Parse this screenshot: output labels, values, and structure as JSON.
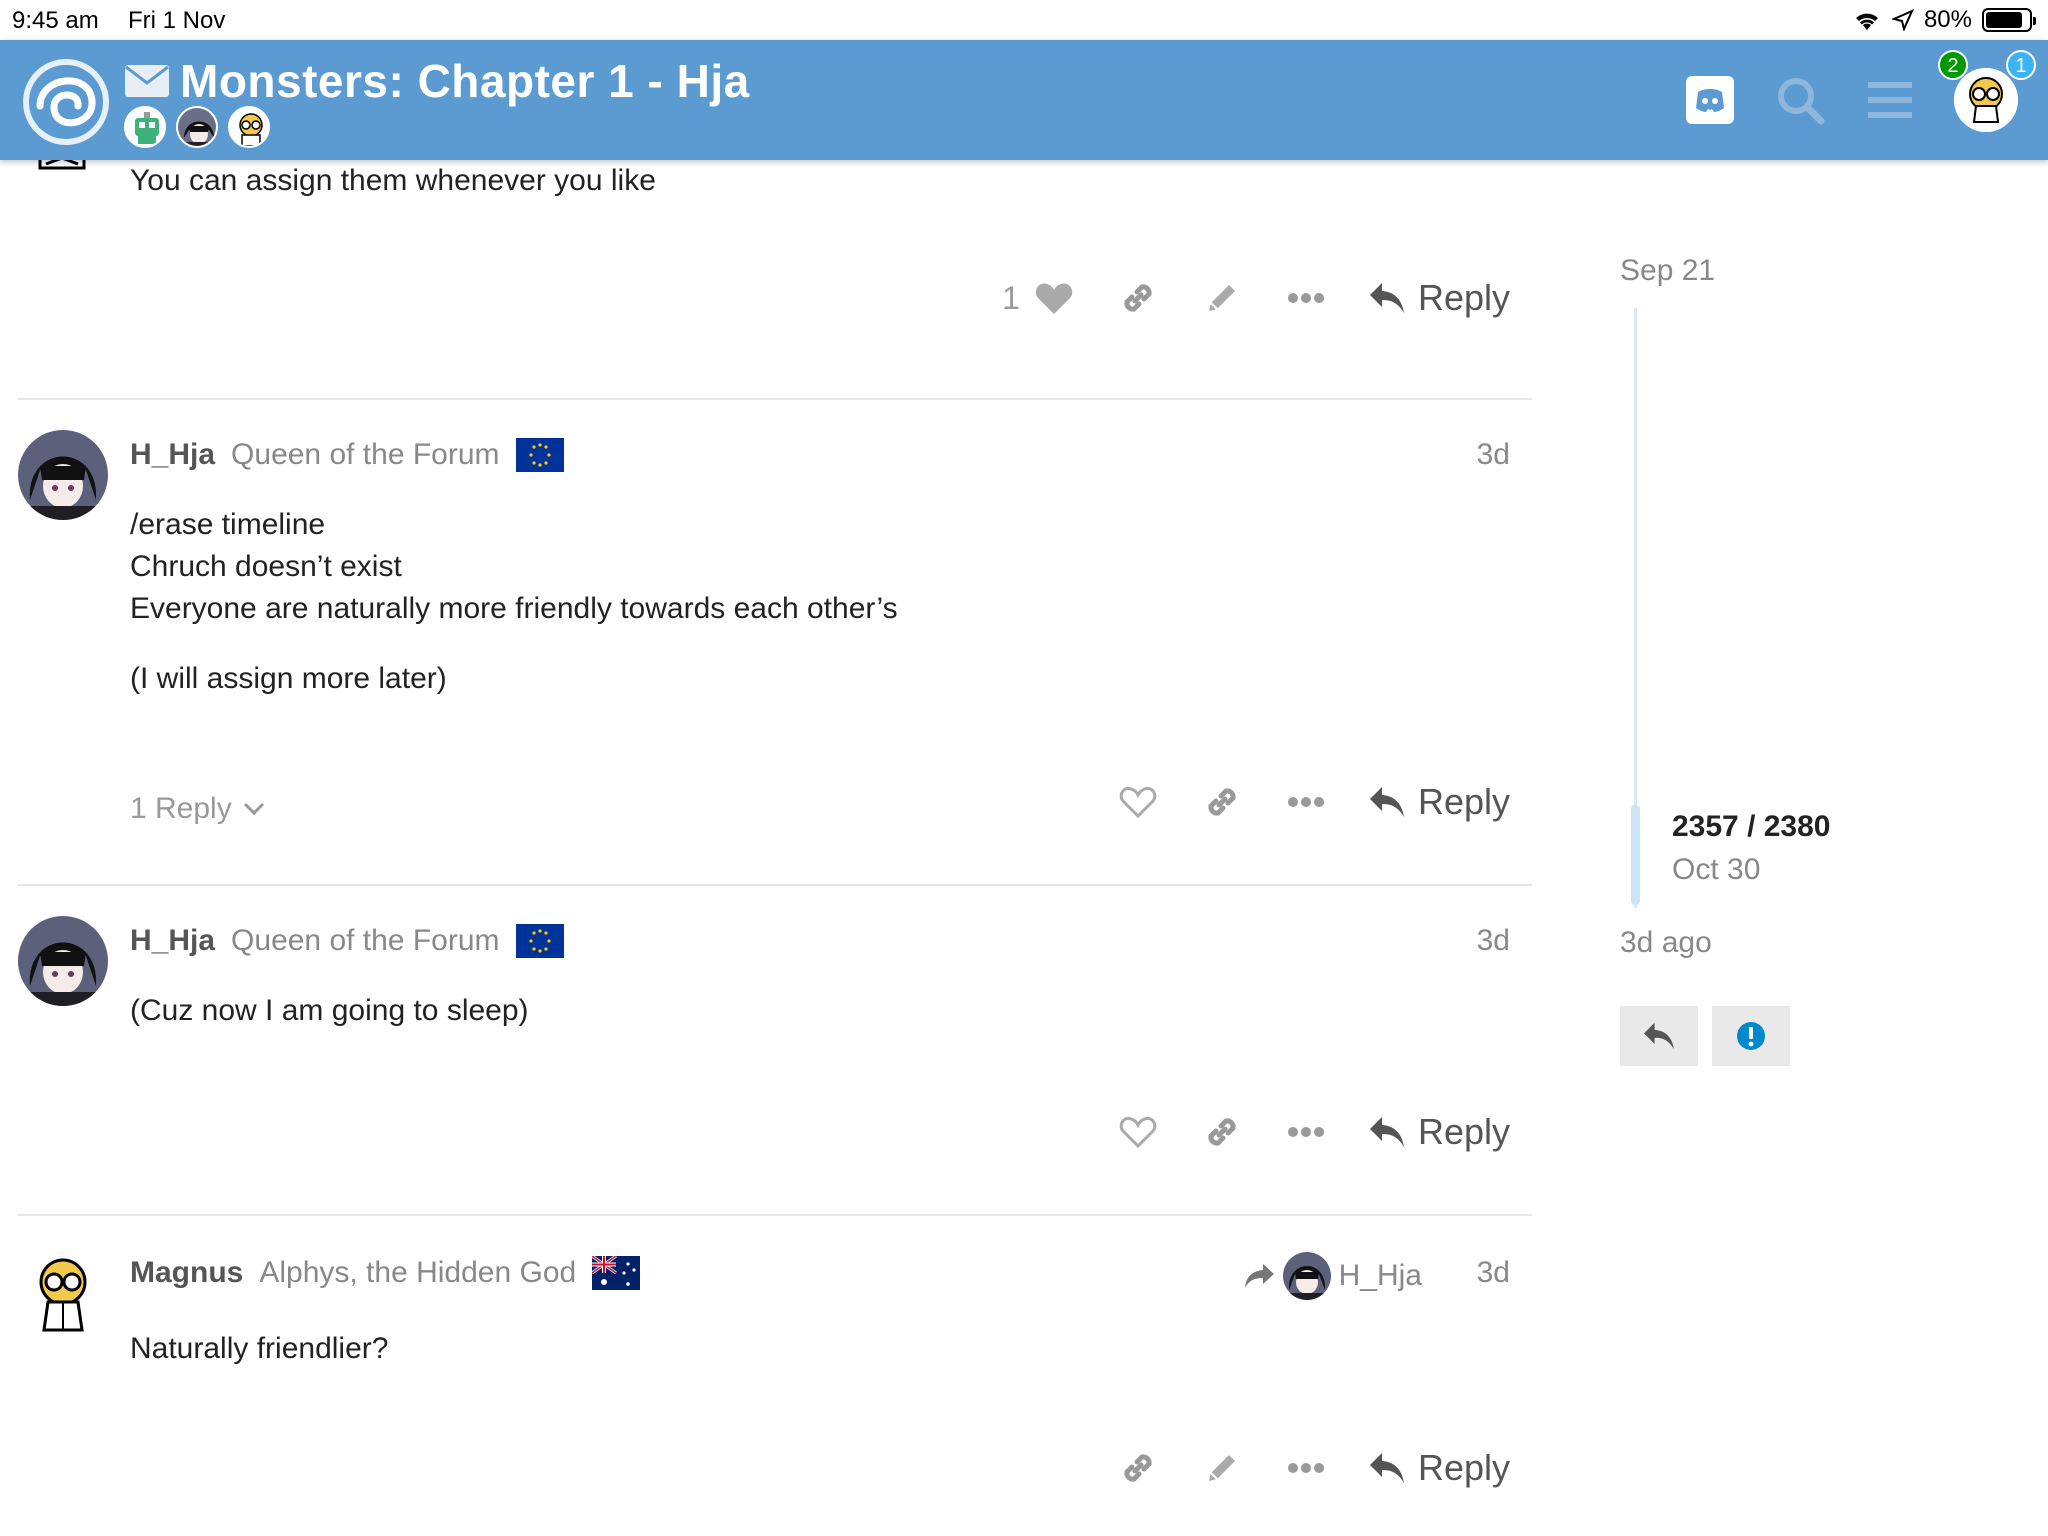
{
  "status_bar": {
    "time": "9:45 am",
    "date": "Fri 1 Nov",
    "battery": "80%"
  },
  "header": {
    "title": "Monsters: Chapter 1 - Hja",
    "notifications": {
      "green": "2",
      "blue": "1"
    }
  },
  "posts": [
    {
      "body": [
        "You can assign them whenever you like"
      ],
      "like_count": "1",
      "reply_label": "Reply"
    },
    {
      "username": "H_Hja",
      "user_title": "Queen of the Forum",
      "date": "3d",
      "body": [
        "/erase timeline",
        "Chruch doesn’t exist",
        "Everyone are naturally more friendly towards each other’s",
        "(I will assign more later)"
      ],
      "replies_toggle": "1 Reply",
      "reply_label": "Reply"
    },
    {
      "username": "H_Hja",
      "user_title": "Queen of the Forum",
      "date": "3d",
      "body": [
        "(Cuz now I am going to sleep)"
      ],
      "reply_label": "Reply"
    },
    {
      "username": "Magnus",
      "user_title": "Alphys, the Hidden God",
      "reply_to": "H_Hja",
      "date": "3d",
      "body": [
        "Naturally friendlier?"
      ],
      "reply_label": "Reply"
    }
  ],
  "timeline": {
    "top_date": "Sep 21",
    "position": "2357 / 2380",
    "position_date": "Oct 30",
    "bottom_label": "3d ago"
  },
  "colors": {
    "header": "#5b9bd1",
    "accent": "#0088cc",
    "muted": "#888888"
  }
}
